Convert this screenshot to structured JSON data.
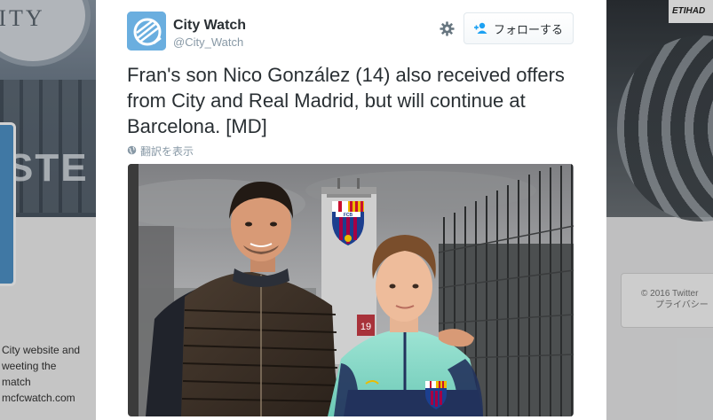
{
  "background": {
    "left_bio": [
      "City website and",
      "weeting the",
      " match",
      "mcfcwatch.com"
    ],
    "left_badge_text": "CITY",
    "left_banner_text": "STE",
    "right_sign_text": "ETIHAD",
    "footer": {
      "copyright": "© 2016 Twitter",
      "privacy": "プライバシー"
    }
  },
  "tweet": {
    "user_name": "City Watch",
    "user_handle": "@City_Watch",
    "follow_label": "フォローする",
    "text": "Fran's son Nico González (14) also received offers from City and Real Madrid, but will continue at Barcelona. [MD]",
    "translate_label": "翻訳を表示",
    "photo_crest_letters": "FCB",
    "photo_sign_number": "19"
  },
  "colors": {
    "avatar_bg": "#6aaedf",
    "name": "#292f33",
    "muted": "#8899a6",
    "barca_blue": "#1c3f8f",
    "barca_red": "#a50044",
    "barca_gold": "#edbb00"
  },
  "icons": {
    "gear": "gear-icon",
    "follow": "add-user-icon",
    "translate": "globe-icon",
    "avatar": "city-watch-logo"
  }
}
